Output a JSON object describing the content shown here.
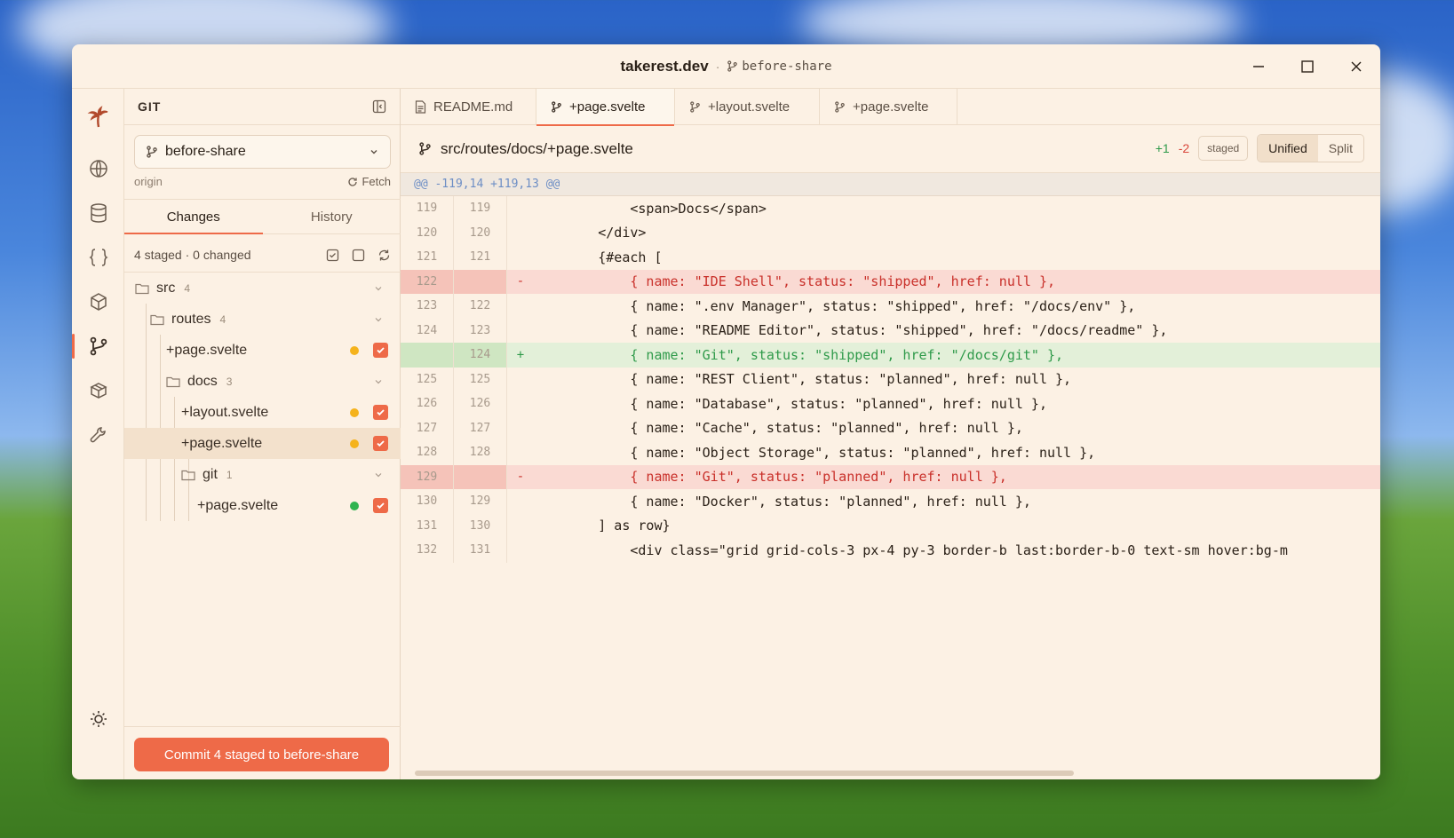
{
  "window": {
    "title": "takerest.dev",
    "separator": "·",
    "branch": "before-share"
  },
  "rail": {
    "items": [
      "palm-logo-icon",
      "globe-icon",
      "database-icon",
      "braces-icon",
      "box-icon",
      "git-branch-icon",
      "package-icon",
      "tools-icon",
      "sun-icon"
    ],
    "active": "git-branch-icon"
  },
  "git_panel": {
    "title": "GIT",
    "branch": "before-share",
    "remote": "origin",
    "fetch_label": "Fetch",
    "tabs": [
      "Changes",
      "History"
    ],
    "summary": "4 staged · 0 changed",
    "tree": [
      {
        "name": "src",
        "type": "folder",
        "count": "4"
      },
      {
        "name": "routes",
        "type": "folder",
        "count": "4"
      },
      {
        "name": "+page.svelte",
        "type": "file",
        "status_color": "#f5b31c"
      },
      {
        "name": "docs",
        "type": "folder",
        "count": "3"
      },
      {
        "name": "+layout.svelte",
        "type": "file",
        "status_color": "#f5b31c"
      },
      {
        "name": "+page.svelte",
        "type": "file",
        "status_color": "#f5b31c",
        "selected": true
      },
      {
        "name": "git",
        "type": "folder",
        "count": "1"
      },
      {
        "name": "+page.svelte",
        "type": "file",
        "status_color": "#2fb34f"
      }
    ],
    "commit_label": "Commit 4 staged to before-share"
  },
  "editor": {
    "tabs": [
      {
        "label": "README.md",
        "icon": "file-icon"
      },
      {
        "label": "+page.svelte",
        "icon": "git-branch-icon",
        "active": true
      },
      {
        "label": "+layout.svelte",
        "icon": "git-branch-icon"
      },
      {
        "label": "+page.svelte",
        "icon": "git-branch-icon"
      }
    ],
    "file_path": "src/routes/docs/+page.svelte",
    "additions": "+1",
    "deletions": "-2",
    "staged_badge": "staged",
    "view_modes": [
      "Unified",
      "Split"
    ],
    "active_view": "Unified",
    "hunk_header": "@@ -119,14 +119,13 @@",
    "lines": [
      {
        "old": "119",
        "new": "119",
        "type": "ctx",
        "sign": "",
        "text": "            <span>Docs</span>"
      },
      {
        "old": "120",
        "new": "120",
        "type": "ctx",
        "sign": "",
        "text": "        </div>"
      },
      {
        "old": "121",
        "new": "121",
        "type": "ctx",
        "sign": "",
        "text": "        {#each ["
      },
      {
        "old": "122",
        "new": "",
        "type": "del",
        "sign": "-",
        "text": "            { name: \"IDE Shell\", status: \"shipped\", href: null },"
      },
      {
        "old": "123",
        "new": "122",
        "type": "ctx",
        "sign": "",
        "text": "            { name: \".env Manager\", status: \"shipped\", href: \"/docs/env\" },"
      },
      {
        "old": "124",
        "new": "123",
        "type": "ctx",
        "sign": "",
        "text": "            { name: \"README Editor\", status: \"shipped\", href: \"/docs/readme\" },"
      },
      {
        "old": "",
        "new": "124",
        "type": "add",
        "sign": "+",
        "text": "            { name: \"Git\", status: \"shipped\", href: \"/docs/git\" },"
      },
      {
        "old": "125",
        "new": "125",
        "type": "ctx",
        "sign": "",
        "text": "            { name: \"REST Client\", status: \"planned\", href: null },"
      },
      {
        "old": "126",
        "new": "126",
        "type": "ctx",
        "sign": "",
        "text": "            { name: \"Database\", status: \"planned\", href: null },"
      },
      {
        "old": "127",
        "new": "127",
        "type": "ctx",
        "sign": "",
        "text": "            { name: \"Cache\", status: \"planned\", href: null },"
      },
      {
        "old": "128",
        "new": "128",
        "type": "ctx",
        "sign": "",
        "text": "            { name: \"Object Storage\", status: \"planned\", href: null },"
      },
      {
        "old": "129",
        "new": "",
        "type": "del",
        "sign": "-",
        "text": "            { name: \"Git\", status: \"planned\", href: null },"
      },
      {
        "old": "130",
        "new": "129",
        "type": "ctx",
        "sign": "",
        "text": "            { name: \"Docker\", status: \"planned\", href: null },"
      },
      {
        "old": "131",
        "new": "130",
        "type": "ctx",
        "sign": "",
        "text": "        ] as row}"
      },
      {
        "old": "132",
        "new": "131",
        "type": "ctx",
        "sign": "",
        "text": "            <div class=\"grid grid-cols-3 px-4 py-3 border-b last:border-b-0 text-sm hover:bg-m"
      }
    ]
  },
  "colors": {
    "accent": "#ee6a48",
    "background": "#fcf1e4",
    "add": "#2f9a4a",
    "del": "#c9302a"
  }
}
